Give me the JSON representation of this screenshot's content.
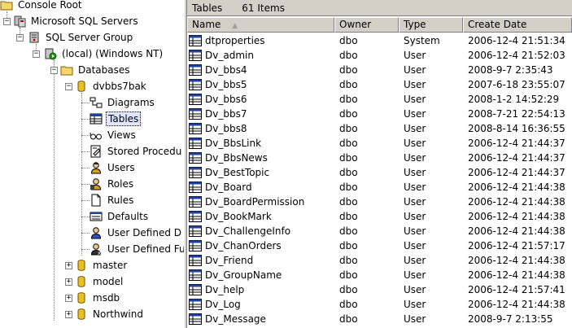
{
  "tree": {
    "console_root": "Console Root",
    "ms_sql_servers": "Microsoft SQL Servers",
    "server_group": "SQL Server Group",
    "local_server": "(local) (Windows NT)",
    "databases": "Databases",
    "db_selected": "dvbbs7bak",
    "db_children": {
      "diagrams": "Diagrams",
      "tables": "Tables",
      "views": "Views",
      "stored_procedures": "Stored Procedu",
      "users": "Users",
      "roles": "Roles",
      "rules": "Rules",
      "defaults": "Defaults",
      "user_defined_types": "User Defined D",
      "user_defined_functions": "User Defined Fu"
    },
    "other_dbs": {
      "master": "master",
      "model": "model",
      "msdb": "msdb",
      "northwind": "Northwind"
    }
  },
  "right_pane": {
    "title": "Tables",
    "item_count": "61 Items",
    "columns": {
      "name": "Name",
      "owner": "Owner",
      "type": "Type",
      "create_date": "Create Date"
    },
    "rows": [
      {
        "name": "dtproperties",
        "owner": "dbo",
        "type": "System",
        "date": "2006-12-4 21:51:34"
      },
      {
        "name": "Dv_admin",
        "owner": "dbo",
        "type": "User",
        "date": "2006-12-4 21:52:03"
      },
      {
        "name": "Dv_bbs4",
        "owner": "dbo",
        "type": "User",
        "date": "2008-9-7 2:35:43"
      },
      {
        "name": "Dv_bbs5",
        "owner": "dbo",
        "type": "User",
        "date": "2007-6-18 23:55:07"
      },
      {
        "name": "Dv_bbs6",
        "owner": "dbo",
        "type": "User",
        "date": "2008-1-2 14:52:29"
      },
      {
        "name": "Dv_bbs7",
        "owner": "dbo",
        "type": "User",
        "date": "2008-7-21 22:54:13"
      },
      {
        "name": "Dv_bbs8",
        "owner": "dbo",
        "type": "User",
        "date": "2008-8-14 16:36:55"
      },
      {
        "name": "Dv_BbsLink",
        "owner": "dbo",
        "type": "User",
        "date": "2006-12-4 21:44:37"
      },
      {
        "name": "Dv_BbsNews",
        "owner": "dbo",
        "type": "User",
        "date": "2006-12-4 21:44:37"
      },
      {
        "name": "Dv_BestTopic",
        "owner": "dbo",
        "type": "User",
        "date": "2006-12-4 21:44:37"
      },
      {
        "name": "Dv_Board",
        "owner": "dbo",
        "type": "User",
        "date": "2006-12-4 21:44:38"
      },
      {
        "name": "Dv_BoardPermission",
        "owner": "dbo",
        "type": "User",
        "date": "2006-12-4 21:44:38"
      },
      {
        "name": "Dv_BookMark",
        "owner": "dbo",
        "type": "User",
        "date": "2006-12-4 21:44:38"
      },
      {
        "name": "Dv_ChallengeInfo",
        "owner": "dbo",
        "type": "User",
        "date": "2006-12-4 21:44:38"
      },
      {
        "name": "Dv_ChanOrders",
        "owner": "dbo",
        "type": "User",
        "date": "2006-12-4 21:57:17"
      },
      {
        "name": "Dv_Friend",
        "owner": "dbo",
        "type": "User",
        "date": "2006-12-4 21:44:38"
      },
      {
        "name": "Dv_GroupName",
        "owner": "dbo",
        "type": "User",
        "date": "2006-12-4 21:44:38"
      },
      {
        "name": "Dv_help",
        "owner": "dbo",
        "type": "User",
        "date": "2006-12-4 21:57:41"
      },
      {
        "name": "Dv_Log",
        "owner": "dbo",
        "type": "User",
        "date": "2006-12-4 21:44:38"
      },
      {
        "name": "Dv_Message",
        "owner": "dbo",
        "type": "User",
        "date": "2008-9-7 2:13:55"
      }
    ]
  },
  "colors": {
    "panel_gray": "#d4d0c8",
    "folder_yellow": "#f5d76e",
    "db_yellow": "#e8c020",
    "selection_blue": "#dfe4ff"
  }
}
